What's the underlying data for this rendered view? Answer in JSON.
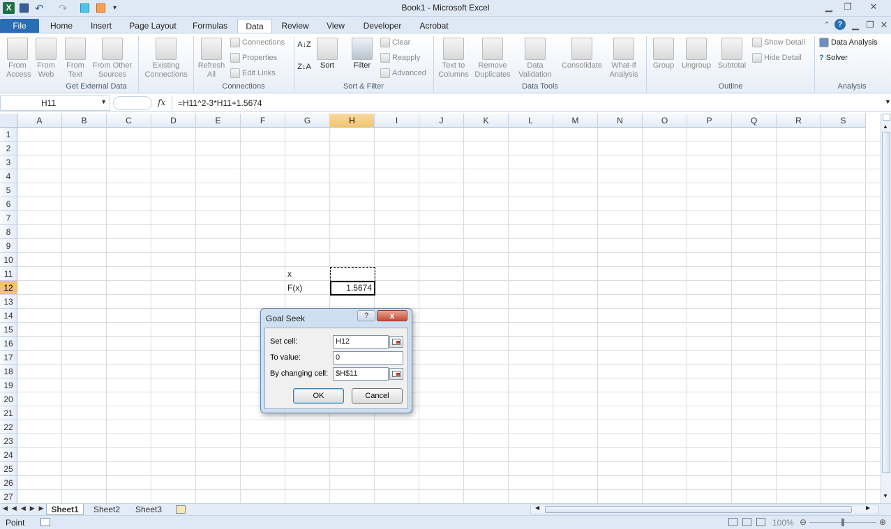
{
  "window": {
    "title": "Book1  -  Microsoft Excel",
    "app_icon": "X",
    "customize_arrow": "▾"
  },
  "qat": {
    "undo_label": "↶",
    "redo_label": "↷"
  },
  "ribbon": {
    "tabs": [
      "File",
      "Home",
      "Insert",
      "Page Layout",
      "Formulas",
      "Data",
      "Review",
      "View",
      "Developer",
      "Acrobat"
    ],
    "active_tab": "Data",
    "groups": {
      "get_external_data": {
        "label": "Get External Data",
        "access": "From Access",
        "web": "From Web",
        "text": "From Text",
        "other_line1": "From Other",
        "other_line2": "Sources",
        "existing_line1": "Existing",
        "existing_line2": "Connections"
      },
      "connections": {
        "label": "Connections",
        "refresh_line1": "Refresh",
        "refresh_line2": "All",
        "connections": "Connections",
        "properties": "Properties",
        "edit_links": "Edit Links"
      },
      "sort_filter": {
        "label": "Sort & Filter",
        "sort": "Sort",
        "filter": "Filter",
        "clear": "Clear",
        "reapply": "Reapply",
        "advanced": "Advanced"
      },
      "data_tools": {
        "label": "Data Tools",
        "ttc_line1": "Text to",
        "ttc_line2": "Columns",
        "rd_line1": "Remove",
        "rd_line2": "Duplicates",
        "dv_line1": "Data",
        "dv_line2": "Validation",
        "consolidate": "Consolidate",
        "wi_line1": "What-If",
        "wi_line2": "Analysis"
      },
      "outline": {
        "label": "Outline",
        "group": "Group",
        "ungroup": "Ungroup",
        "subtotal": "Subtotal",
        "show_detail": "Show Detail",
        "hide_detail": "Hide Detail"
      },
      "analysis": {
        "label": "Analysis",
        "data_analysis": "Data Analysis",
        "solver": "Solver"
      }
    }
  },
  "formula_bar": {
    "name_box": "H11",
    "fx": "fx",
    "formula": "=H11^2-3*H11+1.5674"
  },
  "grid": {
    "columns": [
      "A",
      "B",
      "C",
      "D",
      "E",
      "F",
      "G",
      "H",
      "I",
      "J",
      "K",
      "L",
      "M",
      "N",
      "O",
      "P",
      "Q",
      "R",
      "S"
    ],
    "rows": [
      "1",
      "2",
      "3",
      "4",
      "5",
      "6",
      "7",
      "8",
      "9",
      "10",
      "11",
      "12",
      "13",
      "14",
      "15",
      "16",
      "17",
      "18",
      "19",
      "20",
      "21",
      "22",
      "23",
      "24",
      "25",
      "26",
      "27"
    ],
    "selected_column": "H",
    "selected_row": "12",
    "cells": {
      "g11": "x",
      "g12": "F(x)",
      "h12": "1.5674"
    }
  },
  "sheets": [
    "Sheet1",
    "Sheet2",
    "Sheet3"
  ],
  "status": {
    "mode": "Point",
    "zoom": "100%"
  },
  "goal_seek": {
    "title": "Goal Seek",
    "help": "?",
    "close": "x",
    "set_cell_label": "Set cell:",
    "set_cell_value": "H12",
    "to_value_label": "To value:",
    "to_value_value": "0",
    "changing_cell_label": "By changing cell:",
    "changing_cell_value": "$H$11",
    "ok": "OK",
    "cancel": "Cancel"
  }
}
